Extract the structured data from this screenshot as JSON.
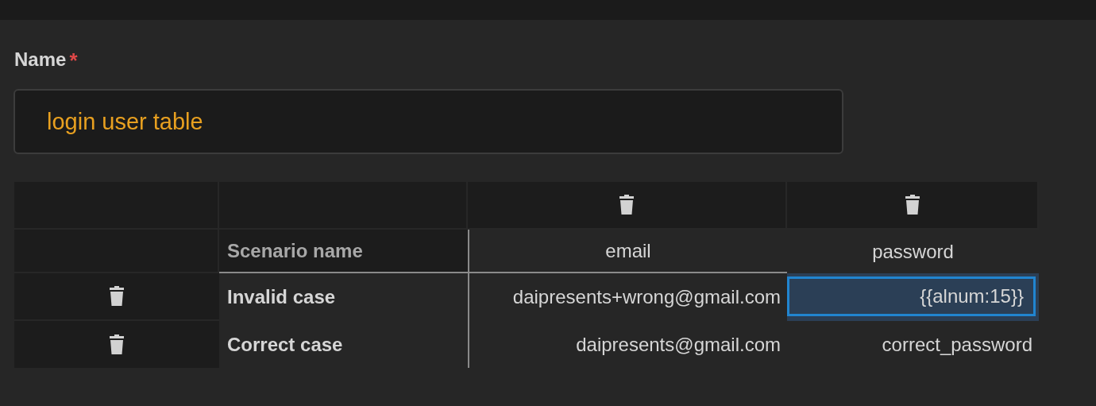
{
  "field": {
    "label": "Name",
    "required_mark": "*",
    "value": "login user table"
  },
  "table": {
    "columns": [
      {
        "label": "Scenario name",
        "deletable": false
      },
      {
        "label": "email",
        "deletable": true
      },
      {
        "label": "password",
        "deletable": true
      }
    ],
    "rows": [
      {
        "cells": [
          {
            "text": "Invalid case",
            "selected": false
          },
          {
            "text": "daipresents+wrong@gmail.com",
            "selected": false
          },
          {
            "text": "{{alnum:15}}",
            "selected": true
          }
        ]
      },
      {
        "cells": [
          {
            "text": "Correct case",
            "selected": false
          },
          {
            "text": "daipresents@gmail.com",
            "selected": false
          },
          {
            "text": "correct_password",
            "selected": false
          }
        ]
      }
    ]
  }
}
